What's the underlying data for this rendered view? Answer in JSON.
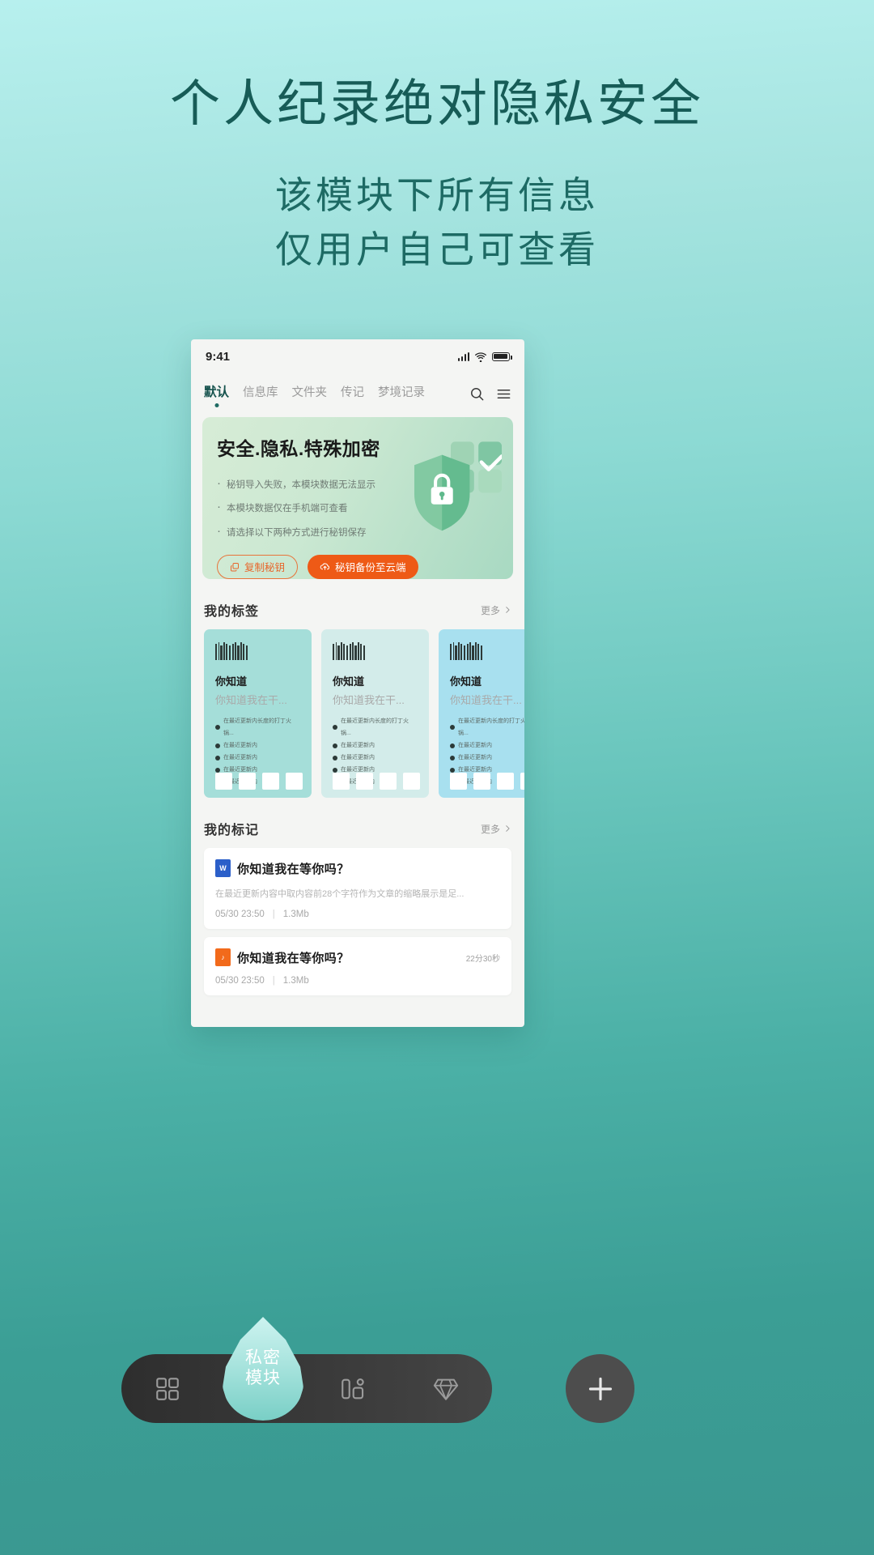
{
  "hero": {
    "title": "个人纪录绝对隐私安全",
    "sub_line1": "该模块下所有信息",
    "sub_line2": "仅用户自己可查看"
  },
  "phone": {
    "status": {
      "time": "9:41",
      "signal_icon": "signal-bars-icon",
      "wifi_icon": "wifi-icon",
      "battery_icon": "battery-icon"
    },
    "tabs": [
      {
        "label": "默认",
        "active": true
      },
      {
        "label": "信息库",
        "active": false
      },
      {
        "label": "文件夹",
        "active": false
      },
      {
        "label": "传记",
        "active": false
      },
      {
        "label": "梦境记录",
        "active": false
      }
    ],
    "tab_actions": [
      {
        "name": "search-icon",
        "label": "搜索"
      },
      {
        "name": "menu-icon",
        "label": "菜单"
      }
    ],
    "security_card": {
      "title": "安全.隐私.特殊加密",
      "bullets": [
        "秘钥导入失败，本模块数据无法显示",
        "本模块数据仅在手机端可查看",
        "请选择以下两种方式进行秘钥保存"
      ],
      "copy_button": {
        "label": "复制秘钥",
        "icon": "copy-icon",
        "color": "#e8652a"
      },
      "backup_button": {
        "label": "秘钥备份至云端",
        "icon": "cloud-upload-icon",
        "color": "#ee5a16"
      },
      "art_icon": "shield-lock-icon"
    },
    "tags_section": {
      "title": "我的标签",
      "more_label": "更多",
      "more_icon": "chevron-right-icon",
      "cards": [
        {
          "barcode_icon": "barcode-icon",
          "title": "你知道",
          "subtitle": "你知道我在干...",
          "bg": "#a5ded9",
          "items": [
            "在最近更新内长度的打丁火锅...",
            "在最近更新内",
            "在最近更新内",
            "在最近更新内",
            "在最近更新内"
          ],
          "squares": 4
        },
        {
          "barcode_icon": "barcode-icon",
          "title": "你知道",
          "subtitle": "你知道我在干...",
          "bg": "#d3ecea",
          "items": [
            "在最近更新内长度的打丁火锅...",
            "在最近更新内",
            "在最近更新内",
            "在最近更新内",
            "在最近更新内"
          ],
          "squares": 4
        },
        {
          "barcode_icon": "barcode-icon",
          "title": "你知道",
          "subtitle": "你知道我在干...",
          "bg": "#a8e0ef",
          "items": [
            "在最近更新内长度的打丁火锅...",
            "在最近更新内",
            "在最近更新内",
            "在最近更新内",
            "在最近更新内"
          ],
          "squares": 4
        }
      ]
    },
    "marks_section": {
      "title": "我的标记",
      "more_label": "更多",
      "more_icon": "chevron-right-icon",
      "items": [
        {
          "file_icon": "word-file-icon",
          "file_badge": "W",
          "file_color": "#2b5fc9",
          "title": "你知道我在等你吗？",
          "desc": "在最近更新内容中取内容前28个字符作为文章的缩略展示是足...",
          "date": "05/30 23:50",
          "size": "1.3Mb",
          "duration": ""
        },
        {
          "file_icon": "audio-file-icon",
          "file_badge": "♪",
          "file_color": "#f26a1b",
          "title": "你知道我在等你吗？",
          "desc": "",
          "date": "05/30 23:50",
          "size": "1.3Mb",
          "duration": "22分30秒"
        }
      ]
    }
  },
  "bottom_nav": {
    "items": [
      {
        "name": "grid-icon",
        "label": ""
      },
      {
        "name": "private-module-drop",
        "label_line1": "私密",
        "label_line2": "模块",
        "active": true
      },
      {
        "name": "layout-icon",
        "label": ""
      },
      {
        "name": "diamond-icon",
        "label": ""
      }
    ],
    "add_button": {
      "name": "plus-icon",
      "label": "+"
    }
  }
}
